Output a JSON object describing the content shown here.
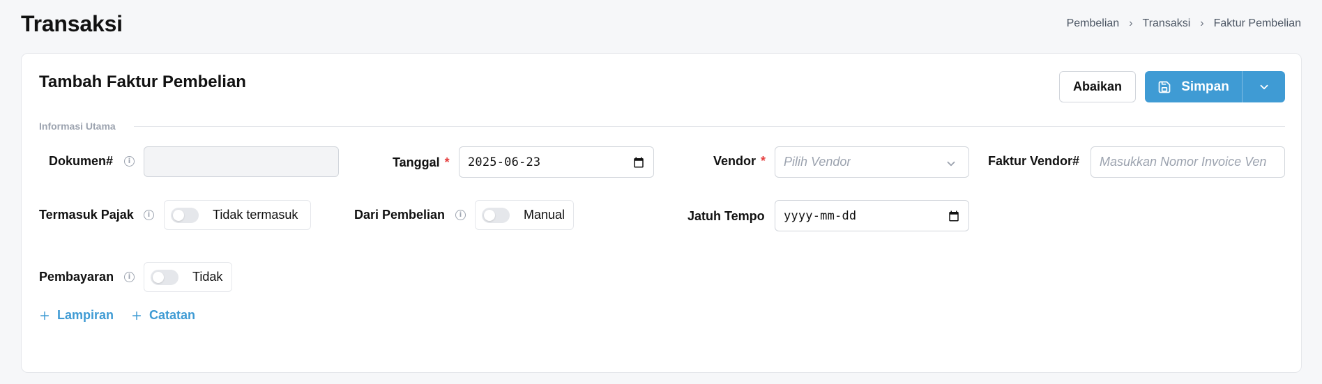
{
  "page": {
    "title": "Transaksi",
    "breadcrumb": [
      "Pembelian",
      "Transaksi",
      "Faktur Pembelian"
    ]
  },
  "form": {
    "title": "Tambah Faktur Pembelian",
    "cancel_label": "Abaikan",
    "save_label": "Simpan",
    "section_label": "Informasi Utama",
    "dokumen": {
      "label": "Dokumen#",
      "value": ""
    },
    "tanggal": {
      "label": "Tanggal",
      "required": "*",
      "value": "2025-06-23"
    },
    "vendor": {
      "label": "Vendor",
      "required": "*",
      "placeholder": "Pilih Vendor"
    },
    "faktur_vendor": {
      "label": "Faktur Vendor#",
      "placeholder": "Masukkan Nomor Invoice Ven"
    },
    "termasuk_pajak": {
      "label": "Termasuk Pajak",
      "toggle_text": "Tidak termasuk",
      "on": false
    },
    "dari_pembelian": {
      "label": "Dari Pembelian",
      "toggle_text": "Manual",
      "on": false
    },
    "jatuh_tempo": {
      "label": "Jatuh Tempo",
      "value": "yyyy-mm-dd"
    },
    "pembayaran": {
      "label": "Pembayaran",
      "toggle_text": "Tidak",
      "on": false
    },
    "add_lampiran": "Lampiran",
    "add_catatan": "Catatan"
  },
  "colors": {
    "accent": "#3f9bd4",
    "required": "#e53e3e",
    "background": "#f6f7f9"
  },
  "icons": {
    "info": "info-icon",
    "calendar": "calendar-icon",
    "save": "save-icon",
    "chevron": "chevron-down-icon",
    "plus": "plus-icon"
  }
}
